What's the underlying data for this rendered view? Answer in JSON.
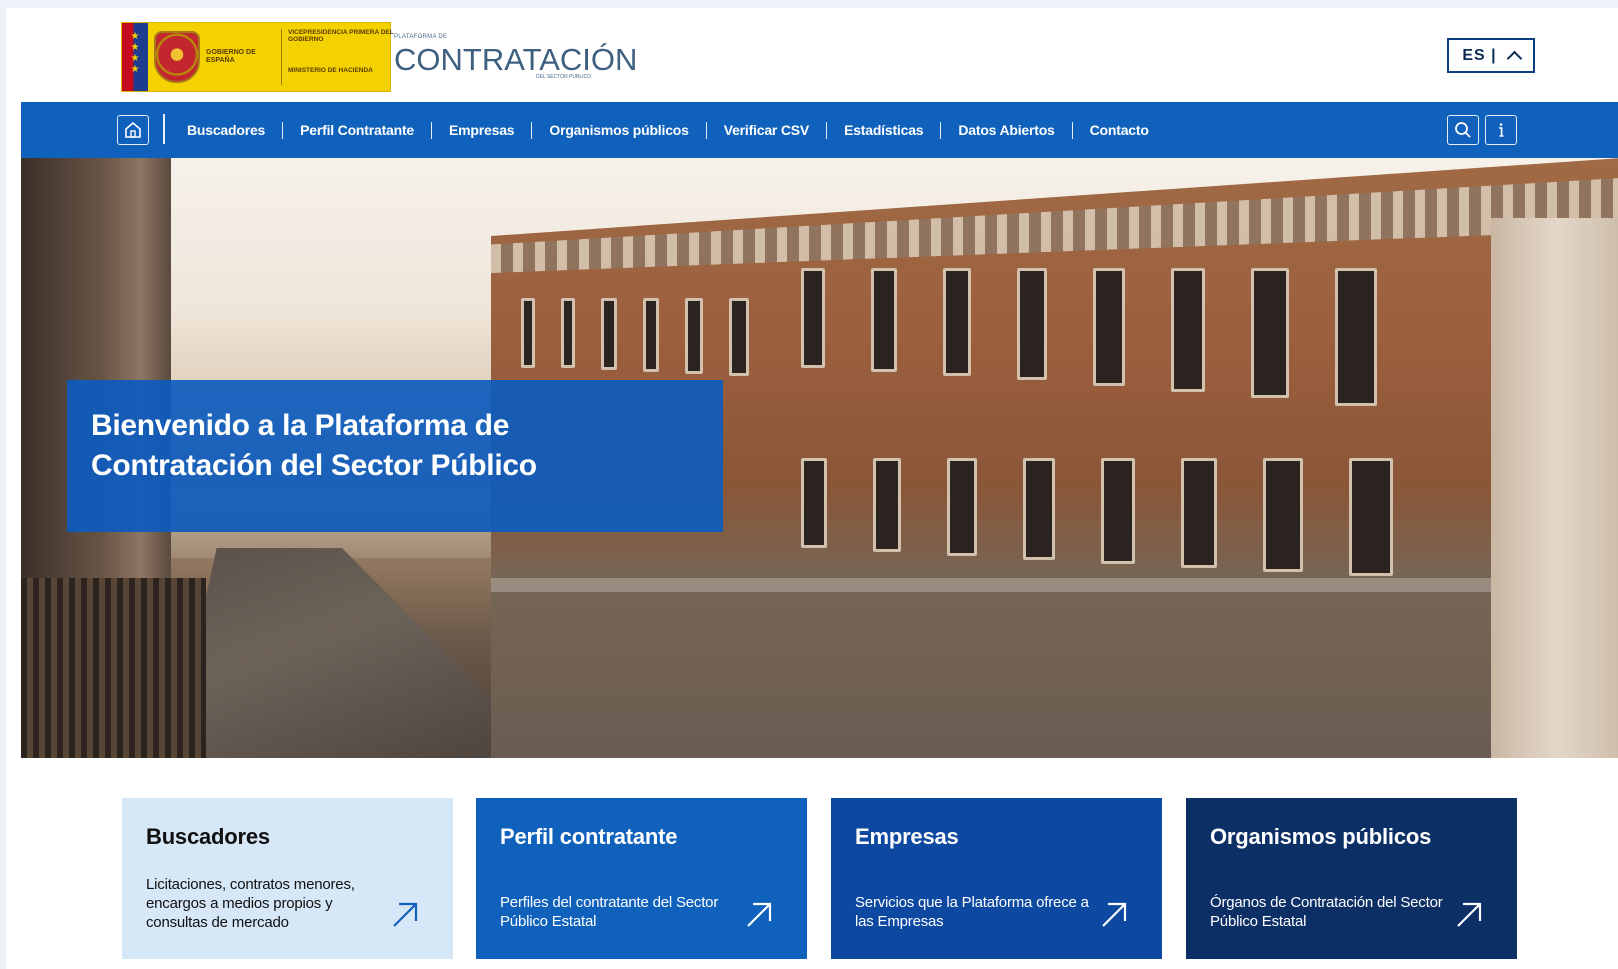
{
  "header": {
    "gov_logo": {
      "left_text": "GOBIERNO DE ESPAÑA",
      "right_text_1": "VICEPRESIDENCIA PRIMERA DEL GOBIERNO",
      "right_text_2": "MINISTERIO DE HACIENDA"
    },
    "platform_logo": {
      "small_text": "PLATAFORMA DE",
      "word": "CONTRATACIÓN",
      "sub_text": "DEL SECTOR PÚBLICO"
    },
    "language": {
      "label": "ES |"
    }
  },
  "nav": {
    "items": [
      {
        "label": "Buscadores"
      },
      {
        "label": "Perfil Contratante"
      },
      {
        "label": "Empresas"
      },
      {
        "label": "Organismos públicos"
      },
      {
        "label": "Verificar CSV"
      },
      {
        "label": "Estadísticas"
      },
      {
        "label": "Datos Abiertos"
      },
      {
        "label": "Contacto"
      }
    ]
  },
  "hero": {
    "title_line1": "Bienvenido a la Plataforma de",
    "title_line2": "Contratación del Sector Público"
  },
  "cards": [
    {
      "title": "Buscadores",
      "description": "Licitaciones, contratos menores, encargos a medios propios y consultas de mercado"
    },
    {
      "title": "Perfil contratante",
      "description": "Perfiles del contratante del Sector Público Estatal"
    },
    {
      "title": "Empresas",
      "description": "Servicios que la Plataforma ofrece a las Empresas"
    },
    {
      "title": "Organismos públicos",
      "description": "Órganos de Contratación del Sector Público Estatal"
    }
  ],
  "colors": {
    "nav_blue": "#0f61bc",
    "card_light": "#d6e7f8",
    "card_mid": "#0d48a1",
    "card_dark": "#0c2f66",
    "gov_yellow": "#f4d100"
  },
  "icons": [
    "home-icon",
    "search-icon",
    "info-icon",
    "chevron-up-icon",
    "arrow-up-right-icon"
  ]
}
